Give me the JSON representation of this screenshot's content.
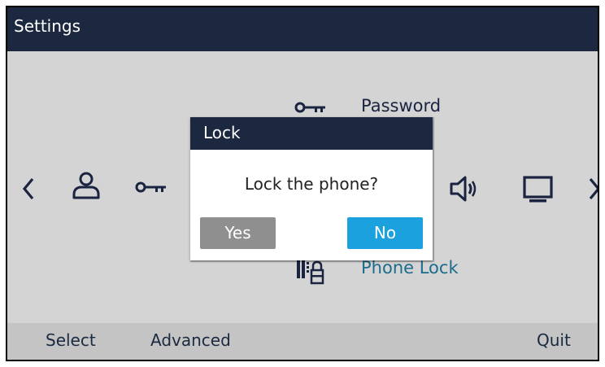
{
  "header": {
    "title": "Settings"
  },
  "menu": {
    "items": [
      {
        "icon": "user-icon"
      },
      {
        "icon": "key-icon",
        "label": "Password"
      },
      {
        "icon": "speaker-icon"
      },
      {
        "icon": "monitor-icon"
      },
      {
        "icon": "phone-lock-icon",
        "label": "Phone Lock"
      }
    ]
  },
  "dialog": {
    "title": "Lock",
    "message": "Lock the phone?",
    "yes_label": "Yes",
    "no_label": "No"
  },
  "softkeys": {
    "left1": "Select",
    "left2": "Advanced",
    "right": "Quit"
  },
  "colors": {
    "header_bg": "#1c2840",
    "screen_bg": "#d4d4d4",
    "accent": "#1ba1de",
    "button_gray": "#8f8f8f",
    "link_blue": "#1b6c8c"
  }
}
